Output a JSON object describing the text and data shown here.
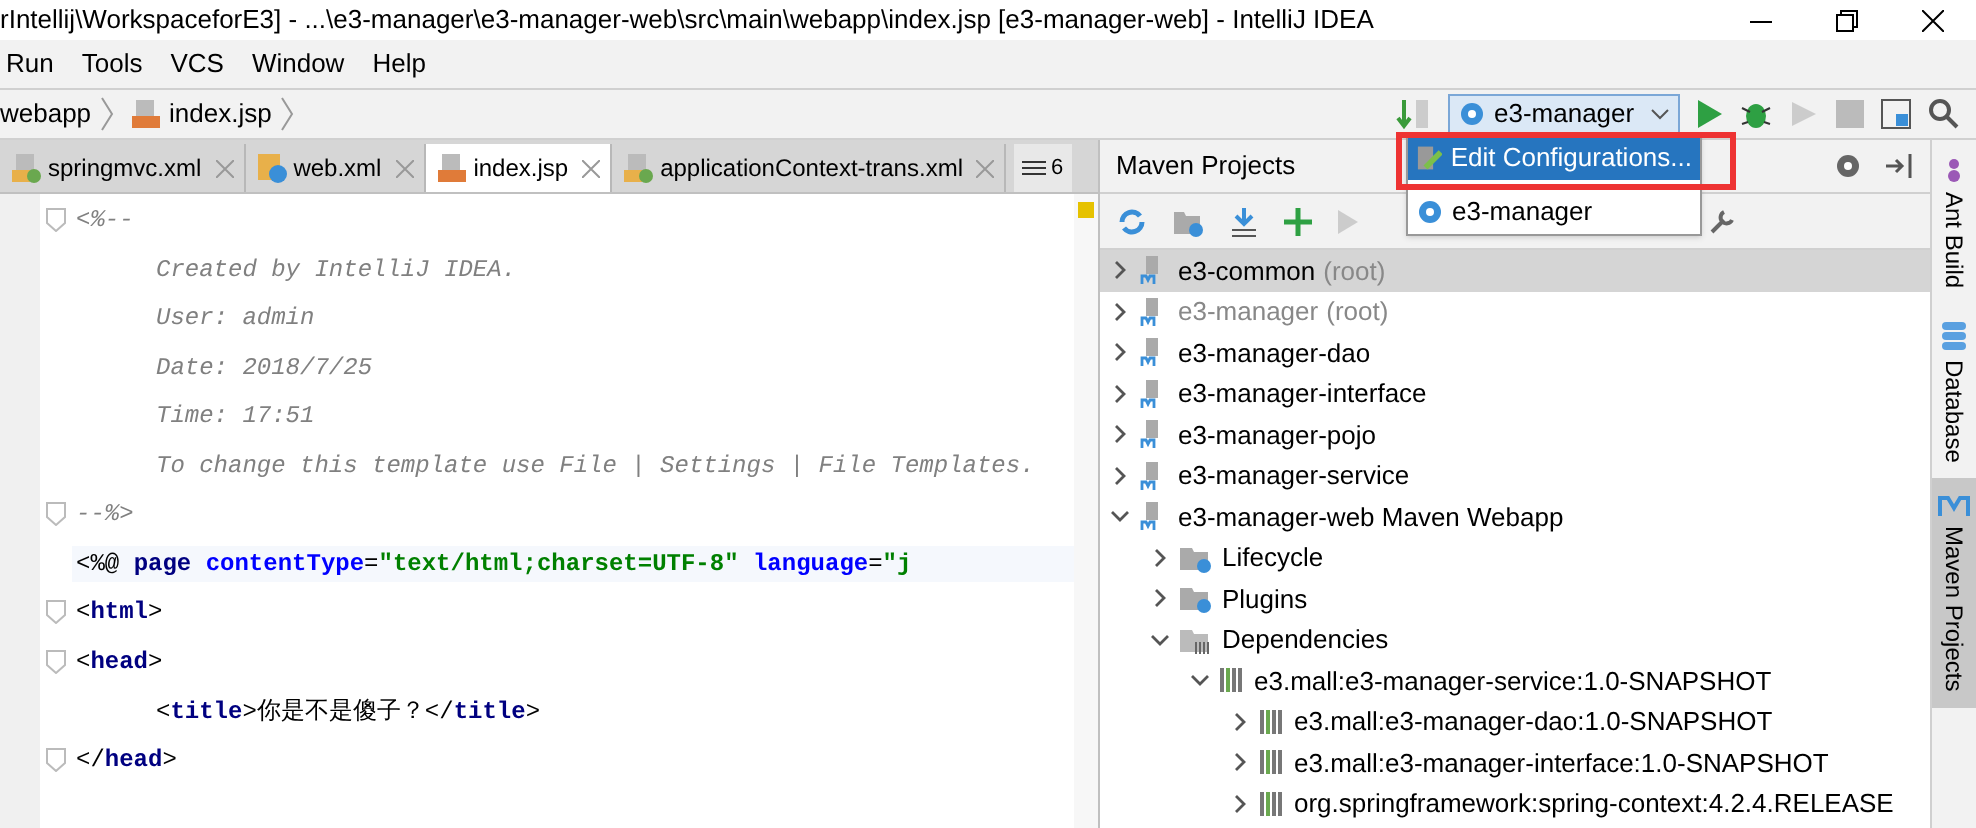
{
  "window": {
    "title": "rIntellij\\WorkspaceforE3] - ...\\e3-manager\\e3-manager-web\\src\\main\\webapp\\index.jsp [e3-manager-web] - IntelliJ IDEA"
  },
  "menu": [
    "Run",
    "Tools",
    "VCS",
    "Window",
    "Help"
  ],
  "breadcrumbs": [
    "webapp",
    "index.jsp"
  ],
  "run_config": {
    "label": "e3-manager"
  },
  "dropdown": [
    {
      "label": "Edit Configurations...",
      "selected": true,
      "kind": "edit"
    },
    {
      "label": "e3-manager",
      "selected": false,
      "kind": "config"
    }
  ],
  "tabs": [
    {
      "label": "springmvc.xml",
      "selected": false,
      "kind": "xml"
    },
    {
      "label": "web.xml",
      "selected": false,
      "kind": "web"
    },
    {
      "label": "index.jsp",
      "selected": true,
      "kind": "jsp"
    },
    {
      "label": "applicationContext-trans.xml",
      "selected": false,
      "kind": "xml"
    }
  ],
  "tab_overflow": "6",
  "editor": {
    "lines": [
      {
        "fold": true,
        "kind": "top",
        "tokens": [
          {
            "kind": "comment",
            "text": "<%--"
          }
        ]
      },
      {
        "fold": false,
        "kind": "indented",
        "tokens": [
          {
            "kind": "comment",
            "text": "Created by IntelliJ IDEA."
          }
        ]
      },
      {
        "fold": false,
        "kind": "indented",
        "tokens": [
          {
            "kind": "comment",
            "text": "User: admin"
          }
        ]
      },
      {
        "fold": false,
        "kind": "indented",
        "tokens": [
          {
            "kind": "comment",
            "text": "Date: 2018/7/25"
          }
        ]
      },
      {
        "fold": false,
        "kind": "indented",
        "tokens": [
          {
            "kind": "comment",
            "text": "Time: 17:51"
          }
        ]
      },
      {
        "fold": false,
        "kind": "indented",
        "tokens": [
          {
            "kind": "comment",
            "text": "To change this template use File | Settings | File Templates."
          }
        ]
      },
      {
        "fold": true,
        "kind": "top",
        "tokens": [
          {
            "kind": "comment",
            "text": "--%>"
          }
        ]
      },
      {
        "fold": false,
        "kind": "top",
        "tokens": [
          {
            "kind": "punct",
            "text": "<%@ "
          },
          {
            "kind": "tag",
            "text": "page "
          },
          {
            "kind": "attr",
            "text": "contentType"
          },
          {
            "kind": "punct",
            "text": "="
          },
          {
            "kind": "string",
            "text": "\"text/html;charset=UTF-8\" "
          },
          {
            "kind": "attr",
            "text": "language"
          },
          {
            "kind": "punct",
            "text": "="
          },
          {
            "kind": "string",
            "text": "\"j"
          }
        ]
      },
      {
        "fold": true,
        "kind": "top",
        "tokens": [
          {
            "kind": "punct",
            "text": "<"
          },
          {
            "kind": "tag",
            "text": "html"
          },
          {
            "kind": "punct",
            "text": ">"
          }
        ]
      },
      {
        "fold": true,
        "kind": "top",
        "tokens": [
          {
            "kind": "punct",
            "text": "<"
          },
          {
            "kind": "tag",
            "text": "head"
          },
          {
            "kind": "punct",
            "text": ">"
          }
        ]
      },
      {
        "fold": false,
        "kind": "indented",
        "tokens": [
          {
            "kind": "punct",
            "text": "<"
          },
          {
            "kind": "tag",
            "text": "title"
          },
          {
            "kind": "punct",
            "text": ">"
          },
          {
            "kind": "text",
            "text": "你是不是傻子？"
          },
          {
            "kind": "punct",
            "text": "</"
          },
          {
            "kind": "tag",
            "text": "title"
          },
          {
            "kind": "punct",
            "text": ">"
          }
        ]
      },
      {
        "fold": true,
        "kind": "top",
        "tokens": [
          {
            "kind": "punct",
            "text": "</"
          },
          {
            "kind": "tag",
            "text": "head"
          },
          {
            "kind": "punct",
            "text": ">"
          }
        ]
      }
    ]
  },
  "maven": {
    "title": "Maven Projects",
    "tree": [
      {
        "label": "e3-common",
        "suffix": "(root)",
        "kind": "module",
        "expanded": false,
        "selected": true,
        "dimmed": false
      },
      {
        "label": "e3-manager",
        "suffix": "(root)",
        "kind": "module",
        "expanded": false,
        "selected": false,
        "dimmed": true
      },
      {
        "label": "e3-manager-dao",
        "kind": "module",
        "expanded": false,
        "selected": false,
        "dimmed": false
      },
      {
        "label": "e3-manager-interface",
        "kind": "module",
        "expanded": false,
        "selected": false,
        "dimmed": false
      },
      {
        "label": "e3-manager-pojo",
        "kind": "module",
        "expanded": false,
        "selected": false,
        "dimmed": false
      },
      {
        "label": "e3-manager-service",
        "kind": "module",
        "expanded": false,
        "selected": false,
        "dimmed": false
      },
      {
        "label": "e3-manager-web Maven Webapp",
        "kind": "module",
        "expanded": true,
        "selected": false,
        "dimmed": false,
        "children": [
          {
            "label": "Lifecycle",
            "kind": "folder",
            "expanded": false,
            "selected": false,
            "dimmed": false
          },
          {
            "label": "Plugins",
            "kind": "folder",
            "expanded": false,
            "selected": false,
            "dimmed": false
          },
          {
            "label": "Dependencies",
            "kind": "deps",
            "expanded": true,
            "selected": false,
            "dimmed": false,
            "children": [
              {
                "label": "e3.mall:e3-manager-service:1.0-SNAPSHOT",
                "kind": "lib",
                "expanded": true,
                "selected": false,
                "dimmed": false,
                "children": [
                  {
                    "label": "e3.mall:e3-manager-dao:1.0-SNAPSHOT",
                    "kind": "lib",
                    "expanded": false,
                    "selected": false,
                    "dimmed": false
                  },
                  {
                    "label": "e3.mall:e3-manager-interface:1.0-SNAPSHOT",
                    "kind": "lib",
                    "expanded": false,
                    "selected": false,
                    "dimmed": false
                  },
                  {
                    "label": "org.springframework:spring-context:4.2.4.RELEASE",
                    "kind": "lib",
                    "expanded": false,
                    "selected": false,
                    "dimmed": false
                  }
                ]
              }
            ]
          }
        ]
      }
    ]
  },
  "side_tabs": [
    {
      "label": "Ant Build",
      "selected": false,
      "kind": "ant"
    },
    {
      "label": "Database",
      "selected": false,
      "kind": "db"
    },
    {
      "label": "Maven Projects",
      "selected": true,
      "kind": "maven"
    }
  ]
}
